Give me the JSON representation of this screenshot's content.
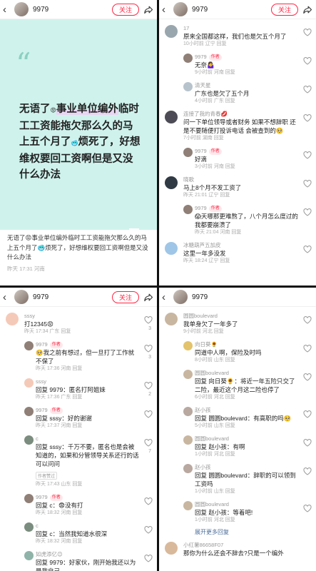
{
  "author": "9979",
  "follow_label": "关注",
  "author_tag": "作者",
  "p1": {
    "quote_mark": "“",
    "note": {
      "a": "无语了",
      "e1": "😡",
      "b": "事业单位",
      "c": "编外",
      "d": "临时工工资能拖欠那么久的马上五个月了",
      "e2": "🥶",
      "f": "烦死了，好想维权要回工资啊但是又没什么办法"
    },
    "desc": "无语了😡事业单位编外临时工工资能拖欠那么久的马上五个月了🥶烦死了，好想维权要回工资啊但是又没什么办法",
    "date": "昨天 17:31 河南"
  },
  "p2": {
    "comments": [
      {
        "name": "17",
        "text": "原来全国都这样，我们也是欠五个月了",
        "meta": "10小时前 辽宁 回复",
        "reply": false,
        "author": false,
        "c": "#9aa6ad"
      },
      {
        "name": "9979",
        "text": "无奈🤷‍♀️",
        "meta": "9小时前 河南 回复",
        "reply": true,
        "author": true,
        "c": "#8f7f76"
      },
      {
        "name": "清天星",
        "text": "广东也是欠了五个月",
        "meta": "4小时前 广东 回复",
        "reply": true,
        "author": false,
        "c": "#b7c3cc"
      },
      {
        "name": "连接了我的青春💋",
        "text": "问一下单位领导或者财务 如果不想辞职 还是不要随便打投诉电话 会被查到的🥺",
        "meta": "7小时前 湖南 回复",
        "reply": false,
        "author": false,
        "c": "#4d4b55"
      },
      {
        "name": "9979",
        "text": "好滴",
        "meta": "3小时前 河南 回复",
        "reply": true,
        "author": true,
        "c": "#8f7f76"
      },
      {
        "name": "晓歌",
        "text": "马上8个月不发工资了",
        "meta": "昨天 21:01 辽宁 回复",
        "reply": false,
        "author": false,
        "c": "#2f3a44"
      },
      {
        "name": "9979",
        "text": "😱天哪那更难熬了，八个月怎么度过的 我都要崩溃了",
        "meta": "昨天 21:04 河南 回复",
        "reply": true,
        "author": true,
        "c": "#8f7f76"
      },
      {
        "name": "冰糖葫芦五加皮",
        "text": "这里一年多没发",
        "meta": "昨天 18:24 辽宁 回复",
        "reply": false,
        "author": false,
        "c": "#9fc6e6"
      }
    ]
  },
  "p3": {
    "comments": [
      {
        "name": "sssy",
        "text": "打12345😡",
        "meta": "昨天 17:34 广东 回复",
        "reply": false,
        "author": false,
        "c": "#f5c9b8",
        "likes": "3"
      },
      {
        "name": "9979",
        "text": "🥺我之前有想过，但一旦打了工作就不保了",
        "meta": "昨天 17:36 河南 回复",
        "reply": true,
        "author": true,
        "c": "#8f7f76",
        "likes": "3"
      },
      {
        "name": "sssy",
        "text": "回复 9979：匿名打阿姐妹",
        "meta": "昨天 17:36 广东 回复",
        "reply": true,
        "author": false,
        "c": "#f5c9b8",
        "likes": "2"
      },
      {
        "name": "9979",
        "text": "回复 sssy：好的谢谢",
        "meta": "昨天 17:37 河南 回复",
        "reply": true,
        "author": true,
        "c": "#8f7f76",
        "likes": ""
      },
      {
        "name": "c",
        "text": "回复 sssy：千万不要，匿名也是会被知道的，如果和分管领导关系还行的话可以问问",
        "meta": "昨天 17:43 山东 回复",
        "reply": true,
        "author": false,
        "c": "#7b8d7e",
        "likes": "7",
        "label": "作者赞过"
      },
      {
        "name": "9979",
        "text": "回复 c：😨没有打",
        "meta": "昨天 18:32 河南 回复",
        "reply": true,
        "author": true,
        "c": "#8f7f76",
        "likes": ""
      },
      {
        "name": "c",
        "text": "回复 c：当然我知道水很深",
        "meta": "昨天 18:32 河南 回复",
        "reply": true,
        "author": false,
        "c": "#7b8d7e",
        "likes": ""
      },
      {
        "name": "如虎添亿😊",
        "text": "回复 9979：好家伙，刚开始我还以为是我自己",
        "meta": "",
        "reply": true,
        "author": false,
        "c": "#8fb3a8",
        "likes": ""
      }
    ]
  },
  "p4": {
    "comments": [
      {
        "name": "圆圆boulevard",
        "text": "我单身欠了一年多了",
        "meta": "9小时前 河北 回复",
        "reply": false,
        "author": false,
        "c": "#c9b6a0"
      },
      {
        "name": "向日葵🌻",
        "text": "同道中人啊，保险及时吗",
        "meta": "8小时前 山东 回复",
        "reply": true,
        "author": false,
        "c": "#e3c36b"
      },
      {
        "name": "圆圆boulevard",
        "text": "回复 向日葵🌻：将近一年五险只交了二险，最近这个月这二险也停了",
        "meta": "6小时前 河北 回复",
        "reply": true,
        "author": false,
        "c": "#c9b6a0"
      },
      {
        "name": "赵小孩",
        "text": "回复 圆圆boulevard：有高职的吗🥺",
        "meta": "5小时前 山东 回复",
        "reply": true,
        "author": false,
        "c": "#b8a8a0"
      },
      {
        "name": "圆圆boulevard",
        "text": "回复 赵小孩：有啊",
        "meta": "1小时前 河北 回复",
        "reply": true,
        "author": false,
        "c": "#c9b6a0"
      },
      {
        "name": "赵小孩",
        "text": "回复 圆圆boulevard：辞职的可以领到工资吗",
        "meta": "1小时前 山东 回复",
        "reply": true,
        "author": false,
        "c": "#b8a8a0"
      },
      {
        "name": "圆圆boulevard",
        "text": "回复 赵小孩：等着吧!",
        "meta": "1小时前 河北 回复",
        "reply": true,
        "author": false,
        "c": "#c9b6a0"
      }
    ],
    "more": "展开更多回复",
    "last": {
      "name": "小红薯86658F07",
      "text": "那你为什么还会不辞去?只是一个编外",
      "c": "#d9b99b"
    }
  }
}
